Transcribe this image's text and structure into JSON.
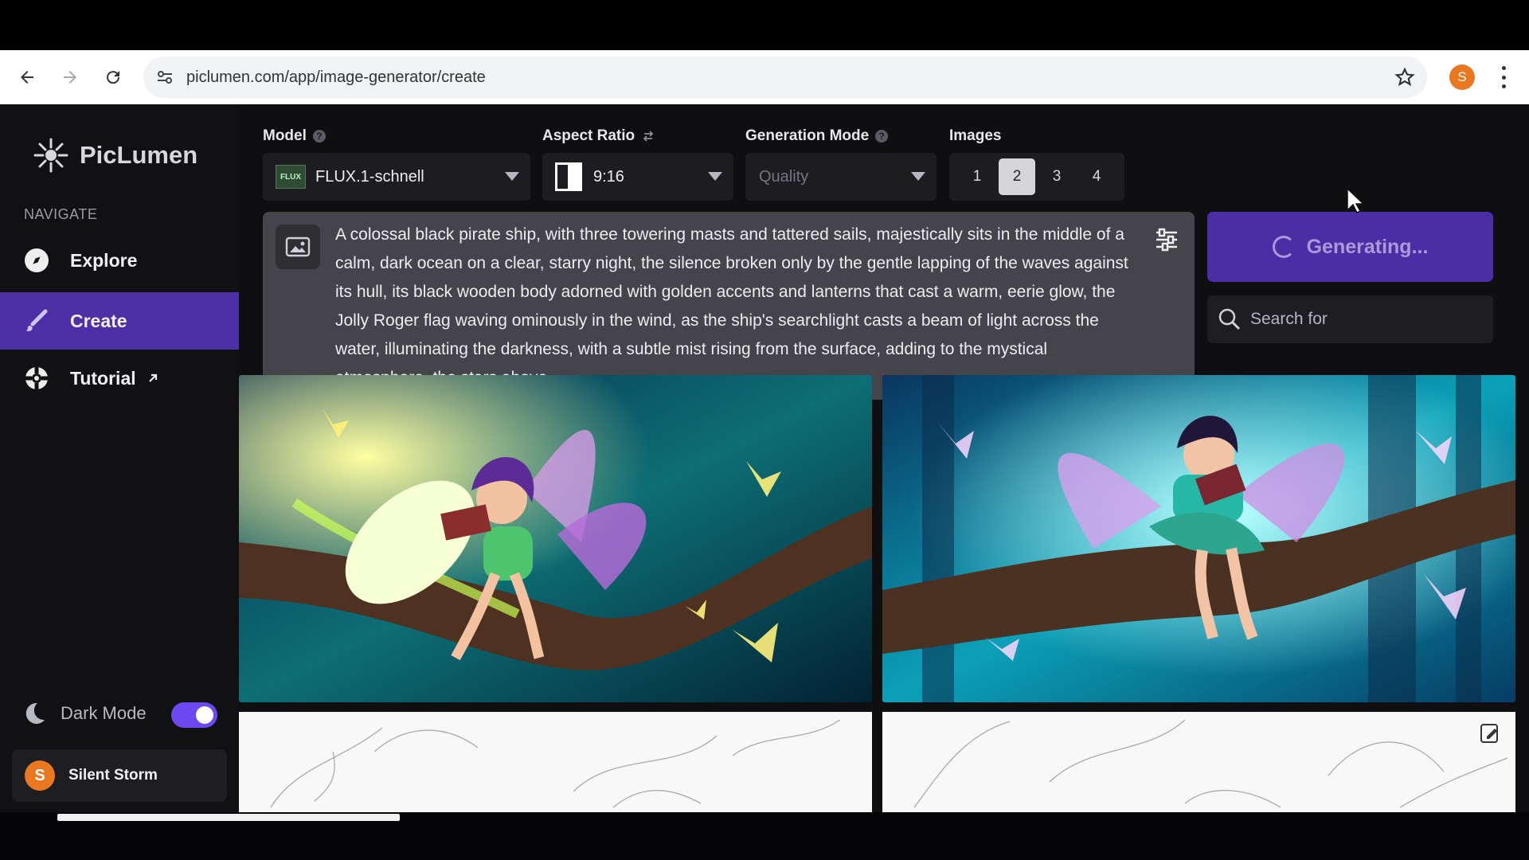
{
  "browser": {
    "url": "piclumen.com/app/image-generator/create",
    "profile_initial": "S",
    "icons": [
      "back-icon",
      "forward-icon",
      "reload-icon",
      "site-info-icon",
      "bookmark-star-icon",
      "kebab-menu-icon"
    ]
  },
  "app": {
    "brand": "PicLumen",
    "nav_heading": "NAVIGATE"
  },
  "sidebar": {
    "items": [
      {
        "label": "Explore",
        "icon": "compass-icon",
        "active": false
      },
      {
        "label": "Create",
        "icon": "brush-icon",
        "active": true
      },
      {
        "label": "Tutorial",
        "icon": "lifebuoy-icon",
        "external_icon": "external-link-icon",
        "active": false
      }
    ],
    "dark_mode_label": "Dark Mode",
    "dark_mode_enabled": true,
    "user": {
      "initial": "S",
      "name": "Silent Storm"
    }
  },
  "controls": {
    "model": {
      "label": "Model",
      "value": "FLUX.1-schnell",
      "thumb": "FLUX"
    },
    "aspect_ratio": {
      "label": "Aspect Ratio",
      "value": "9:16"
    },
    "generation_mode": {
      "label": "Generation Mode",
      "value": "Quality"
    },
    "images": {
      "label": "Images",
      "options": [
        "1",
        "2",
        "3",
        "4"
      ],
      "selected": "2"
    }
  },
  "prompt": {
    "text": "A colossal black pirate ship, with three towering masts and tattered sails, majestically sits in the middle of a calm, dark ocean on a clear, starry night, the silence broken only by the gentle lapping of the waves against its hull, its black wooden body adorned with golden accents and lanterns that cast a warm, eerie glow, the Jolly Roger flag waving ominously in the wind, as the ship's searchlight casts a beam of light across the water, illuminating the darkness, with a subtle mist rising from the surface, adding to the mystical atmosphere, the stars above"
  },
  "generate": {
    "label": "Generating..."
  },
  "search": {
    "placeholder": "Search for"
  },
  "colors": {
    "accent": "#6c48f1",
    "active_nav": "#4d2fa6",
    "avatar": "#e97820",
    "background": "#0f0f12"
  }
}
